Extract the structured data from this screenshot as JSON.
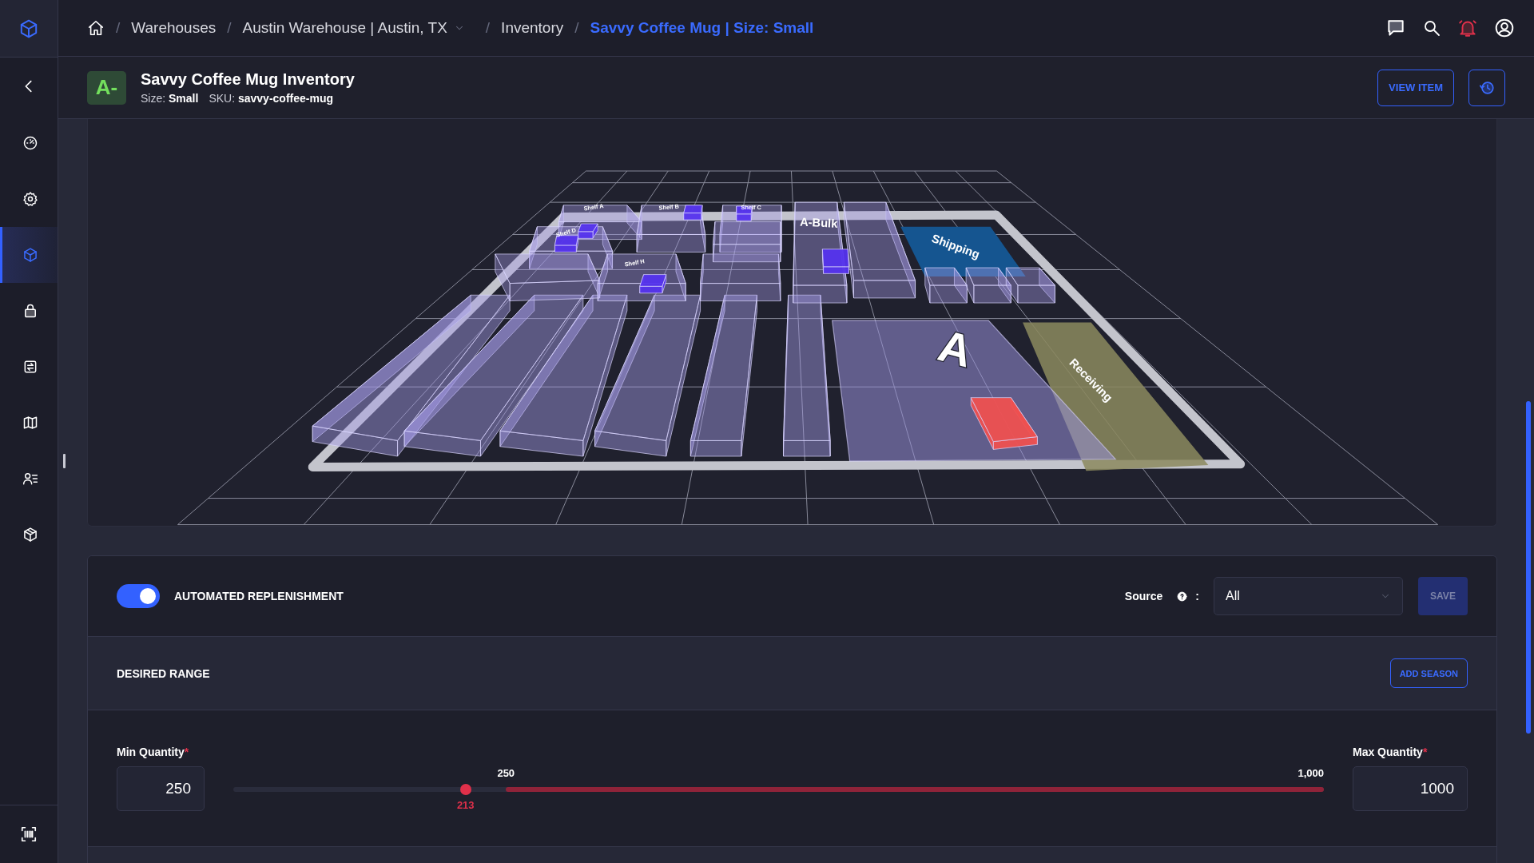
{
  "topbar": {
    "separator": "/",
    "breadcrumbs": [
      {
        "label": "Warehouses",
        "kind": "link"
      },
      {
        "label": "Austin Warehouse | Austin, TX",
        "kind": "dropdown"
      },
      {
        "label": "Inventory",
        "kind": "link"
      },
      {
        "label": "Savvy Coffee Mug | Size: Small",
        "kind": "current"
      }
    ]
  },
  "sidebar": {
    "items": [
      {
        "kind": "gauge",
        "selected": false
      },
      {
        "kind": "gear",
        "selected": false
      },
      {
        "kind": "cube",
        "selected": true
      },
      {
        "kind": "lock",
        "selected": false
      },
      {
        "kind": "transfer",
        "selected": false
      },
      {
        "kind": "map",
        "selected": false
      },
      {
        "kind": "people",
        "selected": false
      },
      {
        "kind": "package",
        "selected": false
      }
    ]
  },
  "header": {
    "badge": "A-",
    "title": "Savvy Coffee Mug Inventory",
    "meta": [
      {
        "label": "Size:",
        "value": "Small"
      },
      {
        "label": "SKU:",
        "value": "savvy-coffee-mug"
      }
    ],
    "button": "VIEW ITEM"
  },
  "scene": {
    "labels": [
      {
        "text": "Shelf A",
        "kind": "shelf"
      },
      {
        "text": "Shelf B",
        "kind": "shelf"
      },
      {
        "text": "Shelf C",
        "kind": "shelf"
      },
      {
        "text": "Shelf D",
        "kind": "shelf"
      },
      {
        "text": "Shelf H",
        "kind": "shelf"
      },
      {
        "text": "A-Bulk",
        "kind": "zone"
      },
      {
        "text": "Shipping",
        "kind": "zone"
      },
      {
        "text": "Receiving",
        "kind": "zone"
      },
      {
        "text": "A",
        "kind": "marker"
      }
    ]
  },
  "replenishment": {
    "toggle": {
      "label": "AUTOMATED REPLENISHMENT",
      "on": true
    },
    "source_label": "Source",
    "source_separator": ":",
    "source_value": "All",
    "save": {
      "label": "SAVE",
      "disabled": true
    }
  },
  "desired_range": {
    "title": "DESIRED RANGE",
    "button": "ADD SEASON"
  },
  "range": {
    "min": {
      "label": "Min Quantity",
      "required_mark": "*",
      "value": "250"
    },
    "max": {
      "label": "Max Quantity",
      "required_mark": "*",
      "value": "1000"
    },
    "slider": {
      "min_label": "250",
      "max_label": "1,000",
      "current": {
        "label": "213",
        "level": 0.213
      }
    }
  }
}
